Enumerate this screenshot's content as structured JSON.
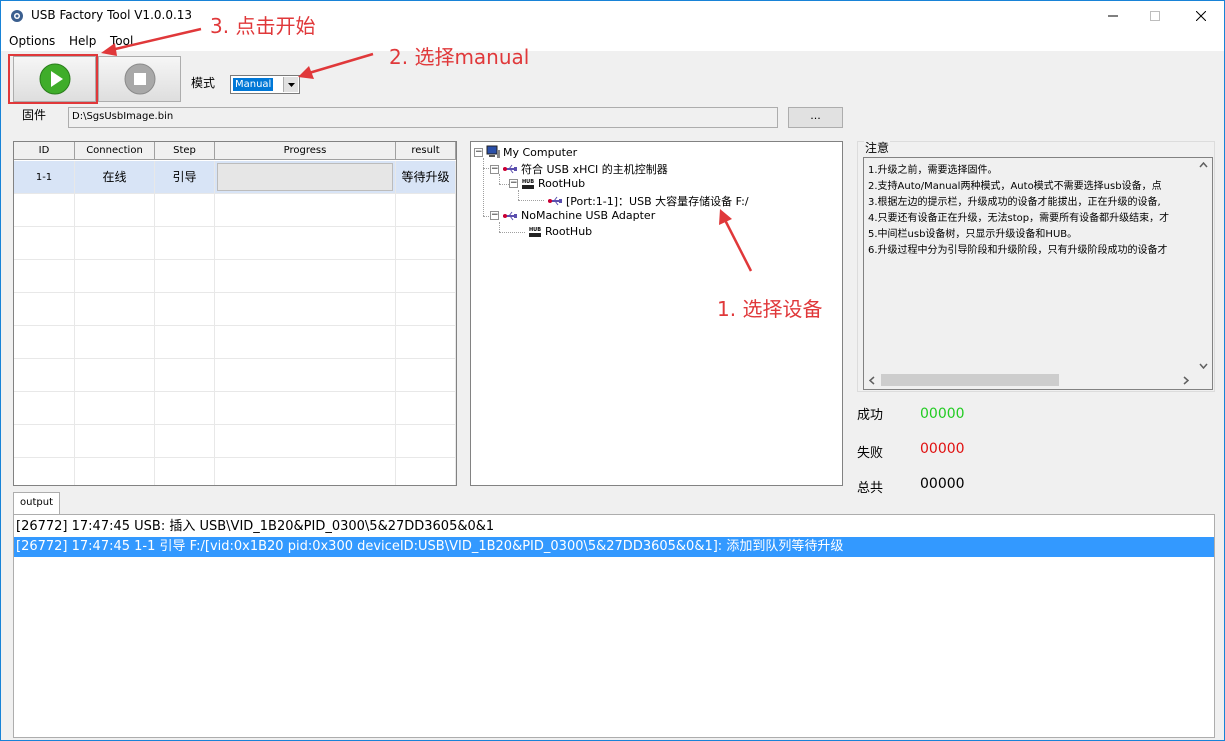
{
  "window": {
    "title": "USB Factory Tool V1.0.0.13"
  },
  "menu": [
    "Options",
    "Help",
    "Tool"
  ],
  "toolbar": {
    "mode_label": "模式",
    "mode_value": "Manual"
  },
  "firmware": {
    "label": "固件",
    "path": "D:\\SgsUsbImage.bin",
    "browse_label": "..."
  },
  "table": {
    "columns": [
      "ID",
      "Connection",
      "Step",
      "Progress",
      "result"
    ],
    "rows": [
      {
        "id": "1-1",
        "connection": "在线",
        "step": "引导",
        "progress": "",
        "result": "等待升级"
      }
    ]
  },
  "tree": {
    "root": "My Computer",
    "controller1": "符合 USB xHCI 的主机控制器",
    "hub1": "RootHub",
    "device": "[Port:1-1]：USB 大容量存储设备  F:/",
    "controller2": "NoMachine USB Adapter",
    "hub2": "RootHub"
  },
  "notes": {
    "title": "注意",
    "lines": [
      "1.升级之前，需要选择固件。",
      "2.支持Auto/Manual两种模式，Auto模式不需要选择usb设备，点",
      "3.根据左边的提示栏，升级成功的设备才能拔出，正在升级的设备,",
      "4.只要还有设备正在升级，无法stop，需要所有设备都升级结束，才",
      "5.中间栏usb设备树，只显示升级设备和HUB。",
      "6.升级过程中分为引导阶段和升级阶段，只有升级阶段成功的设备才"
    ]
  },
  "stats": {
    "success_label": "成功",
    "success_value": "00000",
    "fail_label": "失败",
    "fail_value": "00000",
    "total_label": "总共",
    "total_value": "00000"
  },
  "output": {
    "tab": "output",
    "lines": [
      "[26772] 17:47:45  USB: 插入 USB\\VID_1B20&PID_0300\\5&27DD3605&0&1",
      "[26772] 17:47:45  1-1  引导 F:/[vid:0x1B20  pid:0x300 deviceID:USB\\VID_1B20&PID_0300\\5&27DD3605&0&1]: 添加到队列等待升级"
    ]
  },
  "annotations": {
    "step1": "1. 选择设备",
    "step2": "2. 选择manual",
    "step3": "3. 点击开始"
  },
  "colors": {
    "success": "#22cc22",
    "fail": "#e01010",
    "annotation": "#e0383a",
    "selection": "#3399ff",
    "play": "#3fad2a"
  },
  "icons": [
    "app-icon",
    "minimize-icon",
    "maximize-icon",
    "close-icon",
    "play-icon",
    "stop-icon",
    "dropdown-arrow-icon",
    "computer-icon",
    "usb-icon",
    "hub-icon",
    "scroll-left-icon",
    "scroll-right-icon",
    "scroll-up-icon",
    "scroll-down-icon"
  ]
}
